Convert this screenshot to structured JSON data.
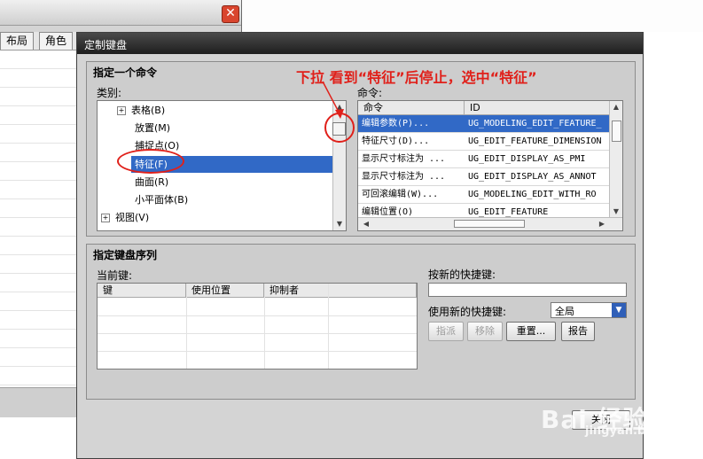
{
  "background_window": {
    "tabs": [
      "布局",
      "角色"
    ],
    "close_glyph": "✕"
  },
  "dialog": {
    "title": "定制键盘",
    "specify_command": {
      "group_label": "指定一个命令",
      "category_label": "类别:",
      "command_label": "命令:",
      "categories": [
        {
          "label": "表格(B)",
          "expandable": true,
          "expander": "+"
        },
        {
          "label": "放置(M)",
          "expandable": false
        },
        {
          "label": "捕捉点(O)",
          "expandable": false
        },
        {
          "label": "特征(F)",
          "expandable": false,
          "selected": true
        },
        {
          "label": "曲面(R)",
          "expandable": false
        },
        {
          "label": "小平面体(B)",
          "expandable": false
        },
        {
          "label": "视图(V)",
          "expandable": true,
          "expander": "+"
        }
      ],
      "command_columns": [
        "命令",
        "ID"
      ],
      "commands": [
        {
          "name": "编辑参数(P)...",
          "id": "UG_MODELING_EDIT_FEATURE_",
          "selected": true
        },
        {
          "name": "特征尺寸(D)...",
          "id": "UG_EDIT_FEATURE_DIMENSION"
        },
        {
          "name": "显示尺寸标注为 ...",
          "id": "UG_EDIT_DISPLAY_AS_PMI"
        },
        {
          "name": "显示尺寸标注为 ...",
          "id": "UG_EDIT_DISPLAY_AS_ANNOT"
        },
        {
          "name": "可回滚编辑(W)...",
          "id": "UG_MODELING_EDIT_WITH_RO"
        },
        {
          "name": "编辑位置(O)",
          "id": "UG_EDIT_FEATURE"
        }
      ]
    },
    "key_sequence": {
      "group_label": "指定键盘序列",
      "current_keys_label": "当前键:",
      "columns": [
        "键",
        "使用位置",
        "抑制者"
      ],
      "new_key_label": "按新的快捷键:",
      "new_key_value": "",
      "use_new_key_label": "使用新的快捷键:",
      "scope_value": "全局",
      "buttons": {
        "assign": "指派",
        "remove": "移除",
        "reset": "重置...",
        "report": "报告"
      }
    },
    "close_button": "关闭"
  },
  "annotation": {
    "text": "下拉  看到“特征”后停止，选中“特征”"
  },
  "watermark": {
    "logo": "Bai 经验",
    "url": "jingyan.baidu.com"
  },
  "colors": {
    "selection": "#3169c6",
    "annotation": "#e0201a",
    "titlebar": "#1e1e1e"
  }
}
